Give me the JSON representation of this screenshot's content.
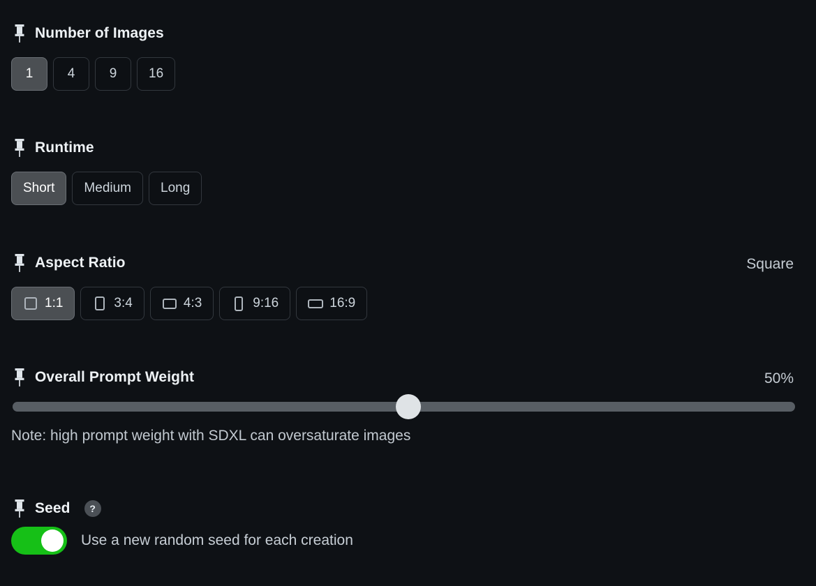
{
  "sections": {
    "images": {
      "title": "Number of Images",
      "pin_icon": "pushpin-icon",
      "options": [
        "1",
        "4",
        "9",
        "16"
      ],
      "selected": "1"
    },
    "runtime": {
      "title": "Runtime",
      "pin_icon": "pushpin-icon",
      "options": [
        "Short",
        "Medium",
        "Long"
      ],
      "selected": "Short"
    },
    "aspect": {
      "title": "Aspect Ratio",
      "pin_icon": "pushpin-icon",
      "value_label": "Square",
      "options": [
        {
          "label": "1:1",
          "icon": "square-ratio-icon"
        },
        {
          "label": "3:4",
          "icon": "portrait-ratio-icon"
        },
        {
          "label": "4:3",
          "icon": "landscape-ratio-icon"
        },
        {
          "label": "9:16",
          "icon": "tall-portrait-ratio-icon"
        },
        {
          "label": "16:9",
          "icon": "wide-landscape-ratio-icon"
        }
      ],
      "selected": "1:1"
    },
    "weight": {
      "title": "Overall Prompt Weight",
      "pin_icon": "pushpin-icon",
      "value_label": "50%",
      "percent": 50,
      "note": "Note: high prompt weight with SDXL can oversaturate images"
    },
    "seed": {
      "title": "Seed",
      "pin_icon": "pushpin-icon",
      "help_icon": "?",
      "toggle_on": true,
      "toggle_label": "Use a new random seed for each creation"
    }
  },
  "colors": {
    "background": "#0e1115",
    "selected_button": "#4b4f53",
    "button_border": "#33383e",
    "toggle_on": "#16c017",
    "slider_track": "#585e64",
    "slider_thumb": "#dfe3e6",
    "text": "#c7ced5",
    "heading": "#eef2f5"
  }
}
